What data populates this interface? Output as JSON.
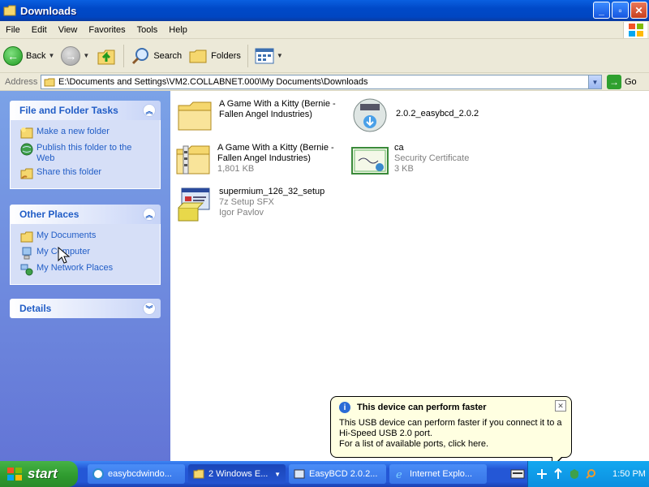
{
  "window": {
    "title": "Downloads",
    "buttons": {
      "minimize": "_",
      "maximize": "▫",
      "close": "✕"
    }
  },
  "menubar": {
    "items": [
      "File",
      "Edit",
      "View",
      "Favorites",
      "Tools",
      "Help"
    ]
  },
  "toolbar": {
    "back_label": "Back",
    "search_label": "Search",
    "folders_label": "Folders"
  },
  "address": {
    "label": "Address",
    "value": "E:\\Documents and Settings\\VM2.COLLABNET.000\\My Documents\\Downloads",
    "go_label": "Go"
  },
  "sidebar": {
    "file_tasks": {
      "title": "File and Folder Tasks",
      "items": [
        {
          "label": "Make a new folder"
        },
        {
          "label": "Publish this folder to the Web"
        },
        {
          "label": "Share this folder"
        }
      ]
    },
    "other_places": {
      "title": "Other Places",
      "items": [
        {
          "label": "My Documents"
        },
        {
          "label": "My Computer"
        },
        {
          "label": "My Network Places"
        }
      ]
    },
    "details": {
      "title": "Details"
    }
  },
  "files": [
    {
      "name": "A Game With a Kitty (Bernie - Fallen Angel Industries)",
      "meta1": "",
      "meta2": ""
    },
    {
      "name": "2.0.2_easybcd_2.0.2",
      "meta1": "",
      "meta2": ""
    },
    {
      "name": "A Game With a Kitty (Bernie - Fallen Angel Industries)",
      "meta1": "1,801 KB",
      "meta2": ""
    },
    {
      "name": "ca",
      "meta1": "Security Certificate",
      "meta2": "3 KB"
    },
    {
      "name": "supermium_126_32_setup",
      "meta1": "7z Setup SFX",
      "meta2": "Igor Pavlov"
    }
  ],
  "balloon": {
    "title": "This device can perform faster",
    "line1": "This USB device can perform faster if you connect it to a Hi-Speed USB 2.0 port.",
    "line2": "For a list of available ports, click here."
  },
  "taskbar": {
    "start_label": "start",
    "tasks": [
      {
        "label": "easybcdwindo..."
      },
      {
        "label": "2 Windows E..."
      },
      {
        "label": "EasyBCD 2.0.2..."
      },
      {
        "label": "Internet Explo..."
      }
    ],
    "clock": "1:50 PM"
  }
}
